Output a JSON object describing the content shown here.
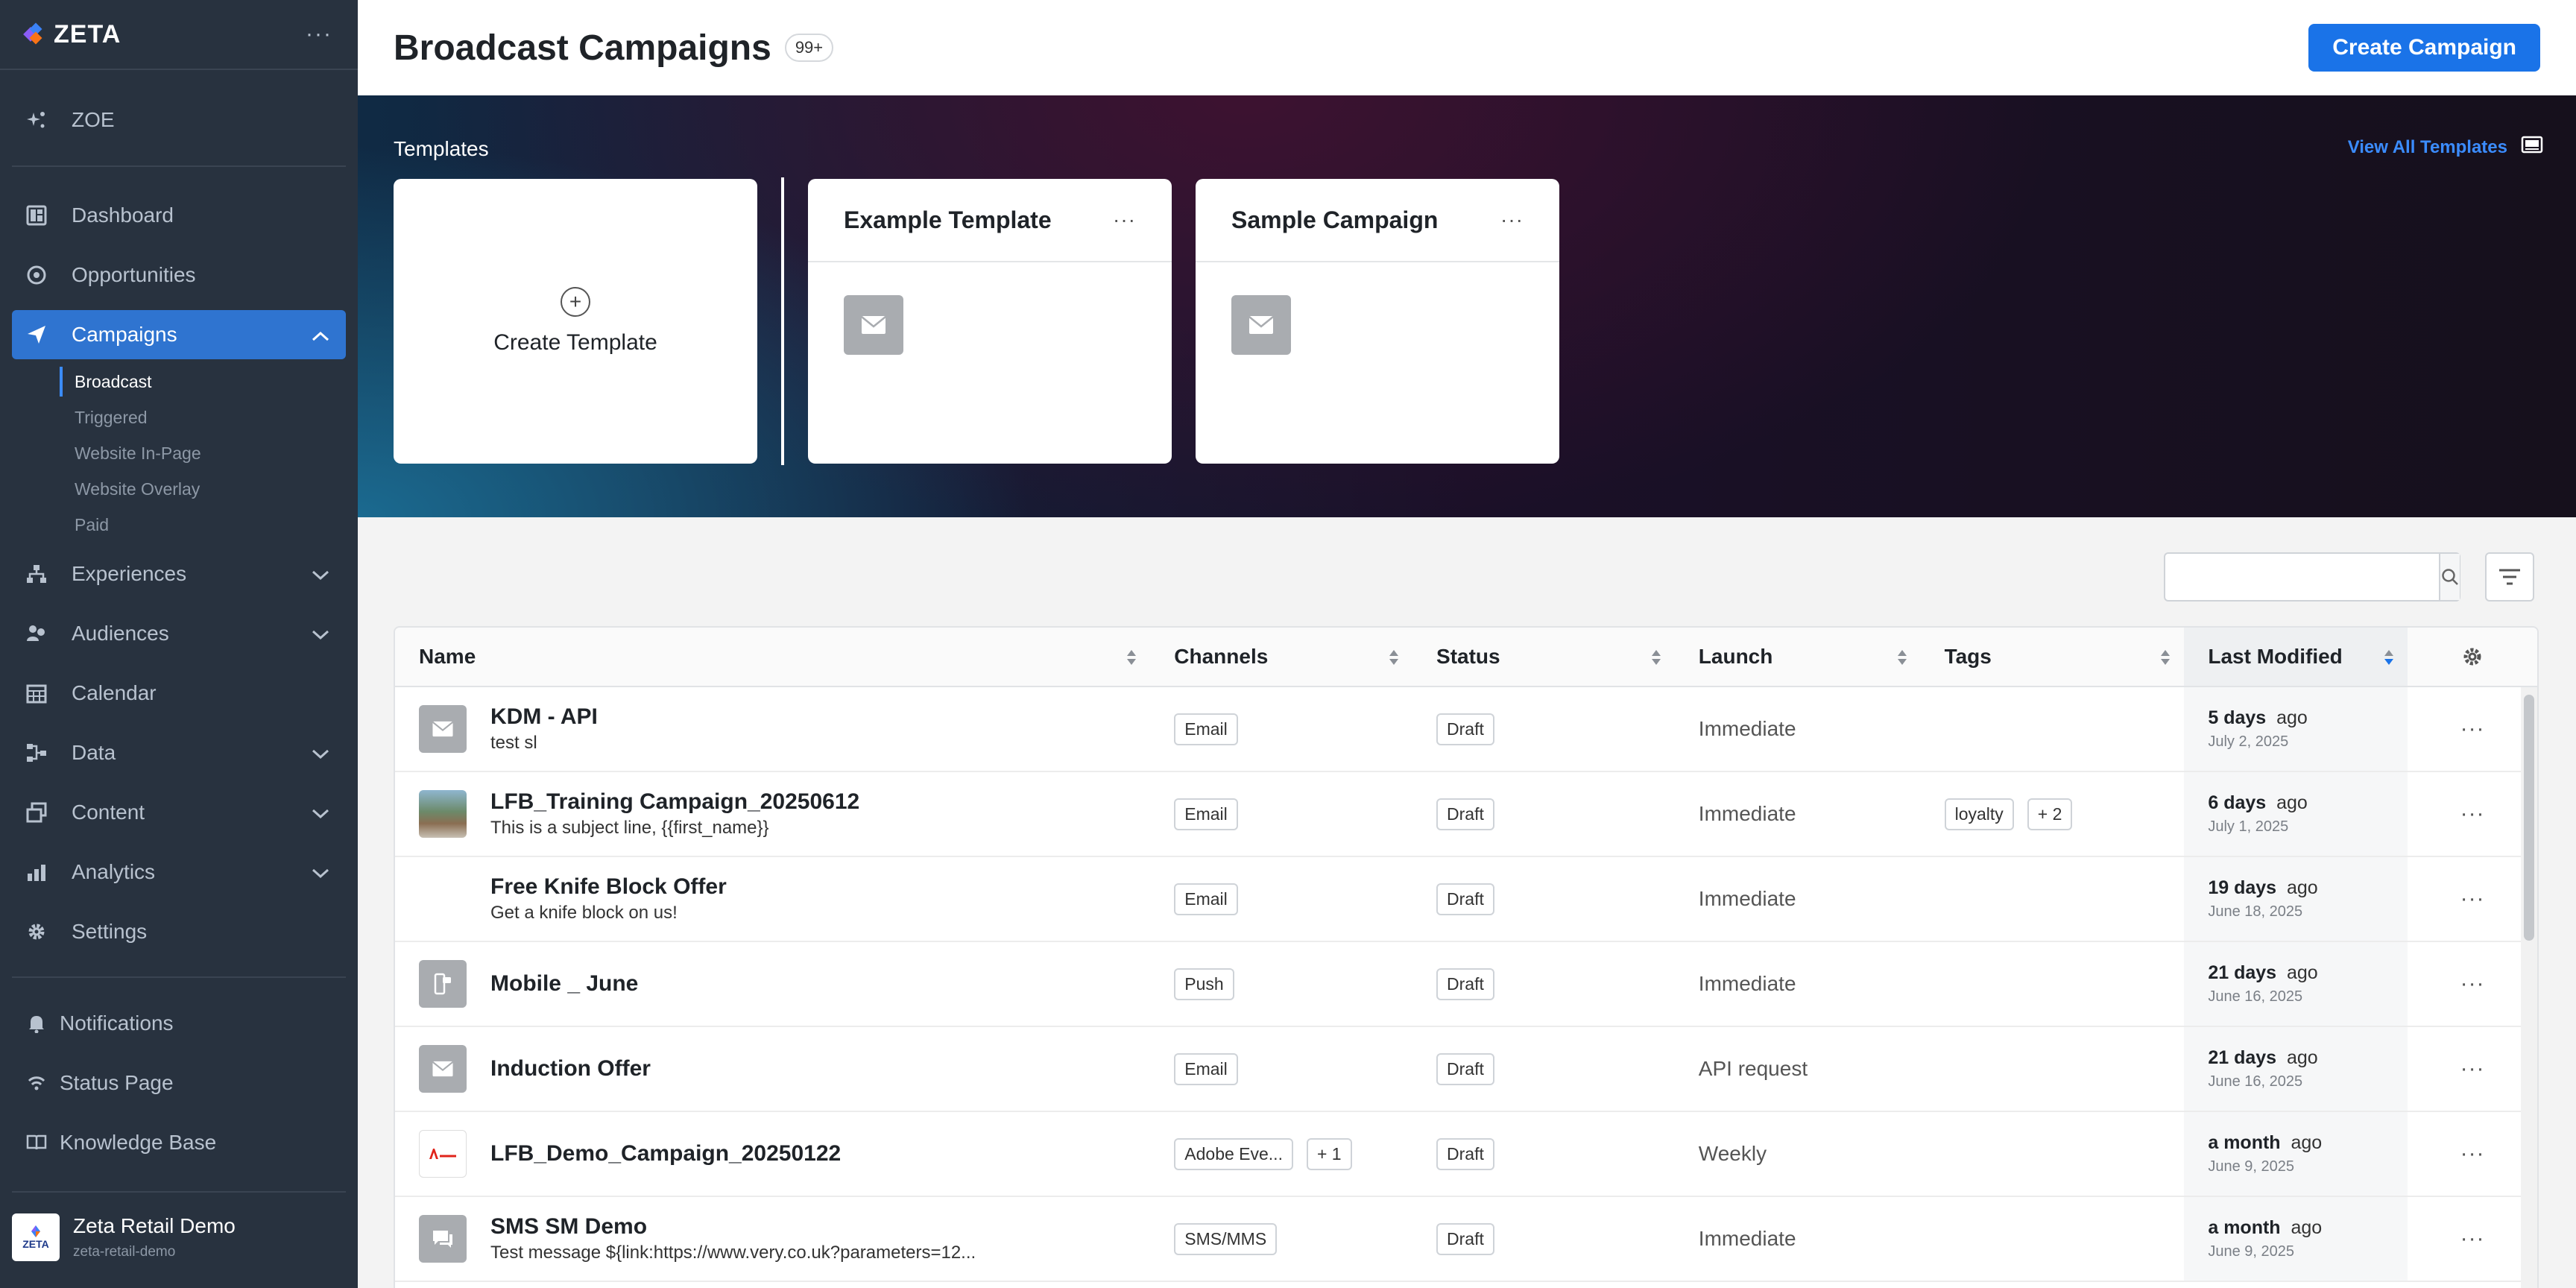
{
  "app": {
    "logo_text": "ZETA"
  },
  "sidebar": {
    "zoe": "ZOE",
    "items": [
      {
        "label": "Dashboard",
        "icon": "dashboard-icon"
      },
      {
        "label": "Opportunities",
        "icon": "target-icon"
      },
      {
        "label": "Campaigns",
        "icon": "paper-plane-icon",
        "active": true
      },
      {
        "label": "Experiences",
        "icon": "hierarchy-icon"
      },
      {
        "label": "Audiences",
        "icon": "people-icon"
      },
      {
        "label": "Calendar",
        "icon": "calendar-icon"
      },
      {
        "label": "Data",
        "icon": "data-flow-icon"
      },
      {
        "label": "Content",
        "icon": "content-icon"
      },
      {
        "label": "Analytics",
        "icon": "analytics-icon"
      },
      {
        "label": "Settings",
        "icon": "gear-icon"
      }
    ],
    "campaign_sub": [
      "Broadcast",
      "Triggered",
      "Website In-Page",
      "Website Overlay",
      "Paid"
    ],
    "bottom": [
      {
        "label": "Notifications",
        "icon": "bell-icon"
      },
      {
        "label": "Status Page",
        "icon": "signal-icon"
      },
      {
        "label": "Knowledge Base",
        "icon": "book-icon"
      }
    ],
    "account": {
      "name": "Zeta Retail Demo",
      "slug": "zeta-retail-demo",
      "logo_text": "ZETA"
    }
  },
  "header": {
    "title": "Broadcast Campaigns",
    "count": "99+",
    "create_label": "Create Campaign"
  },
  "templates": {
    "title": "Templates",
    "view_all": "View All Templates",
    "create_label": "Create Template",
    "cards": [
      {
        "name": "Example Template"
      },
      {
        "name": "Sample Campaign"
      }
    ]
  },
  "search": {
    "placeholder": ""
  },
  "table": {
    "columns": [
      "Name",
      "Channels",
      "Status",
      "Launch",
      "Tags",
      "Last Modified"
    ],
    "sorted_column": "Last Modified",
    "rows": [
      {
        "thumb": "email",
        "name": "KDM - API",
        "sub": "test sl",
        "channels": [
          "Email"
        ],
        "status": "Draft",
        "launch": "Immediate",
        "tags": [],
        "mod_strong": "5 days",
        "mod_rest": "ago",
        "mod_date": "July 2, 2025"
      },
      {
        "thumb": "photo",
        "name": "LFB_Training Campaign_20250612",
        "sub": "This is a subject line, {{first_name}}",
        "channels": [
          "Email"
        ],
        "status": "Draft",
        "launch": "Immediate",
        "tags": [
          "loyalty",
          "+ 2"
        ],
        "mod_strong": "6 days",
        "mod_rest": "ago",
        "mod_date": "July 1, 2025"
      },
      {
        "thumb": "none",
        "name": "Free Knife Block Offer",
        "sub": "Get a knife block on us!",
        "channels": [
          "Email"
        ],
        "status": "Draft",
        "launch": "Immediate",
        "tags": [],
        "mod_strong": "19 days",
        "mod_rest": "ago",
        "mod_date": "June 18, 2025"
      },
      {
        "thumb": "push",
        "name": "Mobile _ June",
        "sub": "",
        "channels": [
          "Push"
        ],
        "status": "Draft",
        "launch": "Immediate",
        "tags": [],
        "mod_strong": "21 days",
        "mod_rest": "ago",
        "mod_date": "June 16, 2025"
      },
      {
        "thumb": "email",
        "name": "Induction Offer",
        "sub": "",
        "channels": [
          "Email"
        ],
        "status": "Draft",
        "launch": "API request",
        "tags": [],
        "mod_strong": "21 days",
        "mod_rest": "ago",
        "mod_date": "June 16, 2025"
      },
      {
        "thumb": "adobe",
        "name": "LFB_Demo_Campaign_20250122",
        "sub": "",
        "channels": [
          "Adobe Eve...",
          "+ 1"
        ],
        "status": "Draft",
        "launch": "Weekly",
        "tags": [],
        "mod_strong": "a month",
        "mod_rest": "ago",
        "mod_date": "June 9, 2025"
      },
      {
        "thumb": "sms",
        "name": "SMS SM Demo",
        "sub": "Test message ${link:https://www.very.co.uk?parameters=12...",
        "channels": [
          "SMS/MMS"
        ],
        "status": "Draft",
        "launch": "Immediate",
        "tags": [],
        "mod_strong": "a month",
        "mod_rest": "ago",
        "mod_date": "June 9, 2025"
      }
    ]
  },
  "colors": {
    "sidebar_bg": "#28323f",
    "accent": "#1a73e8",
    "active_nav": "#2f74d0"
  }
}
